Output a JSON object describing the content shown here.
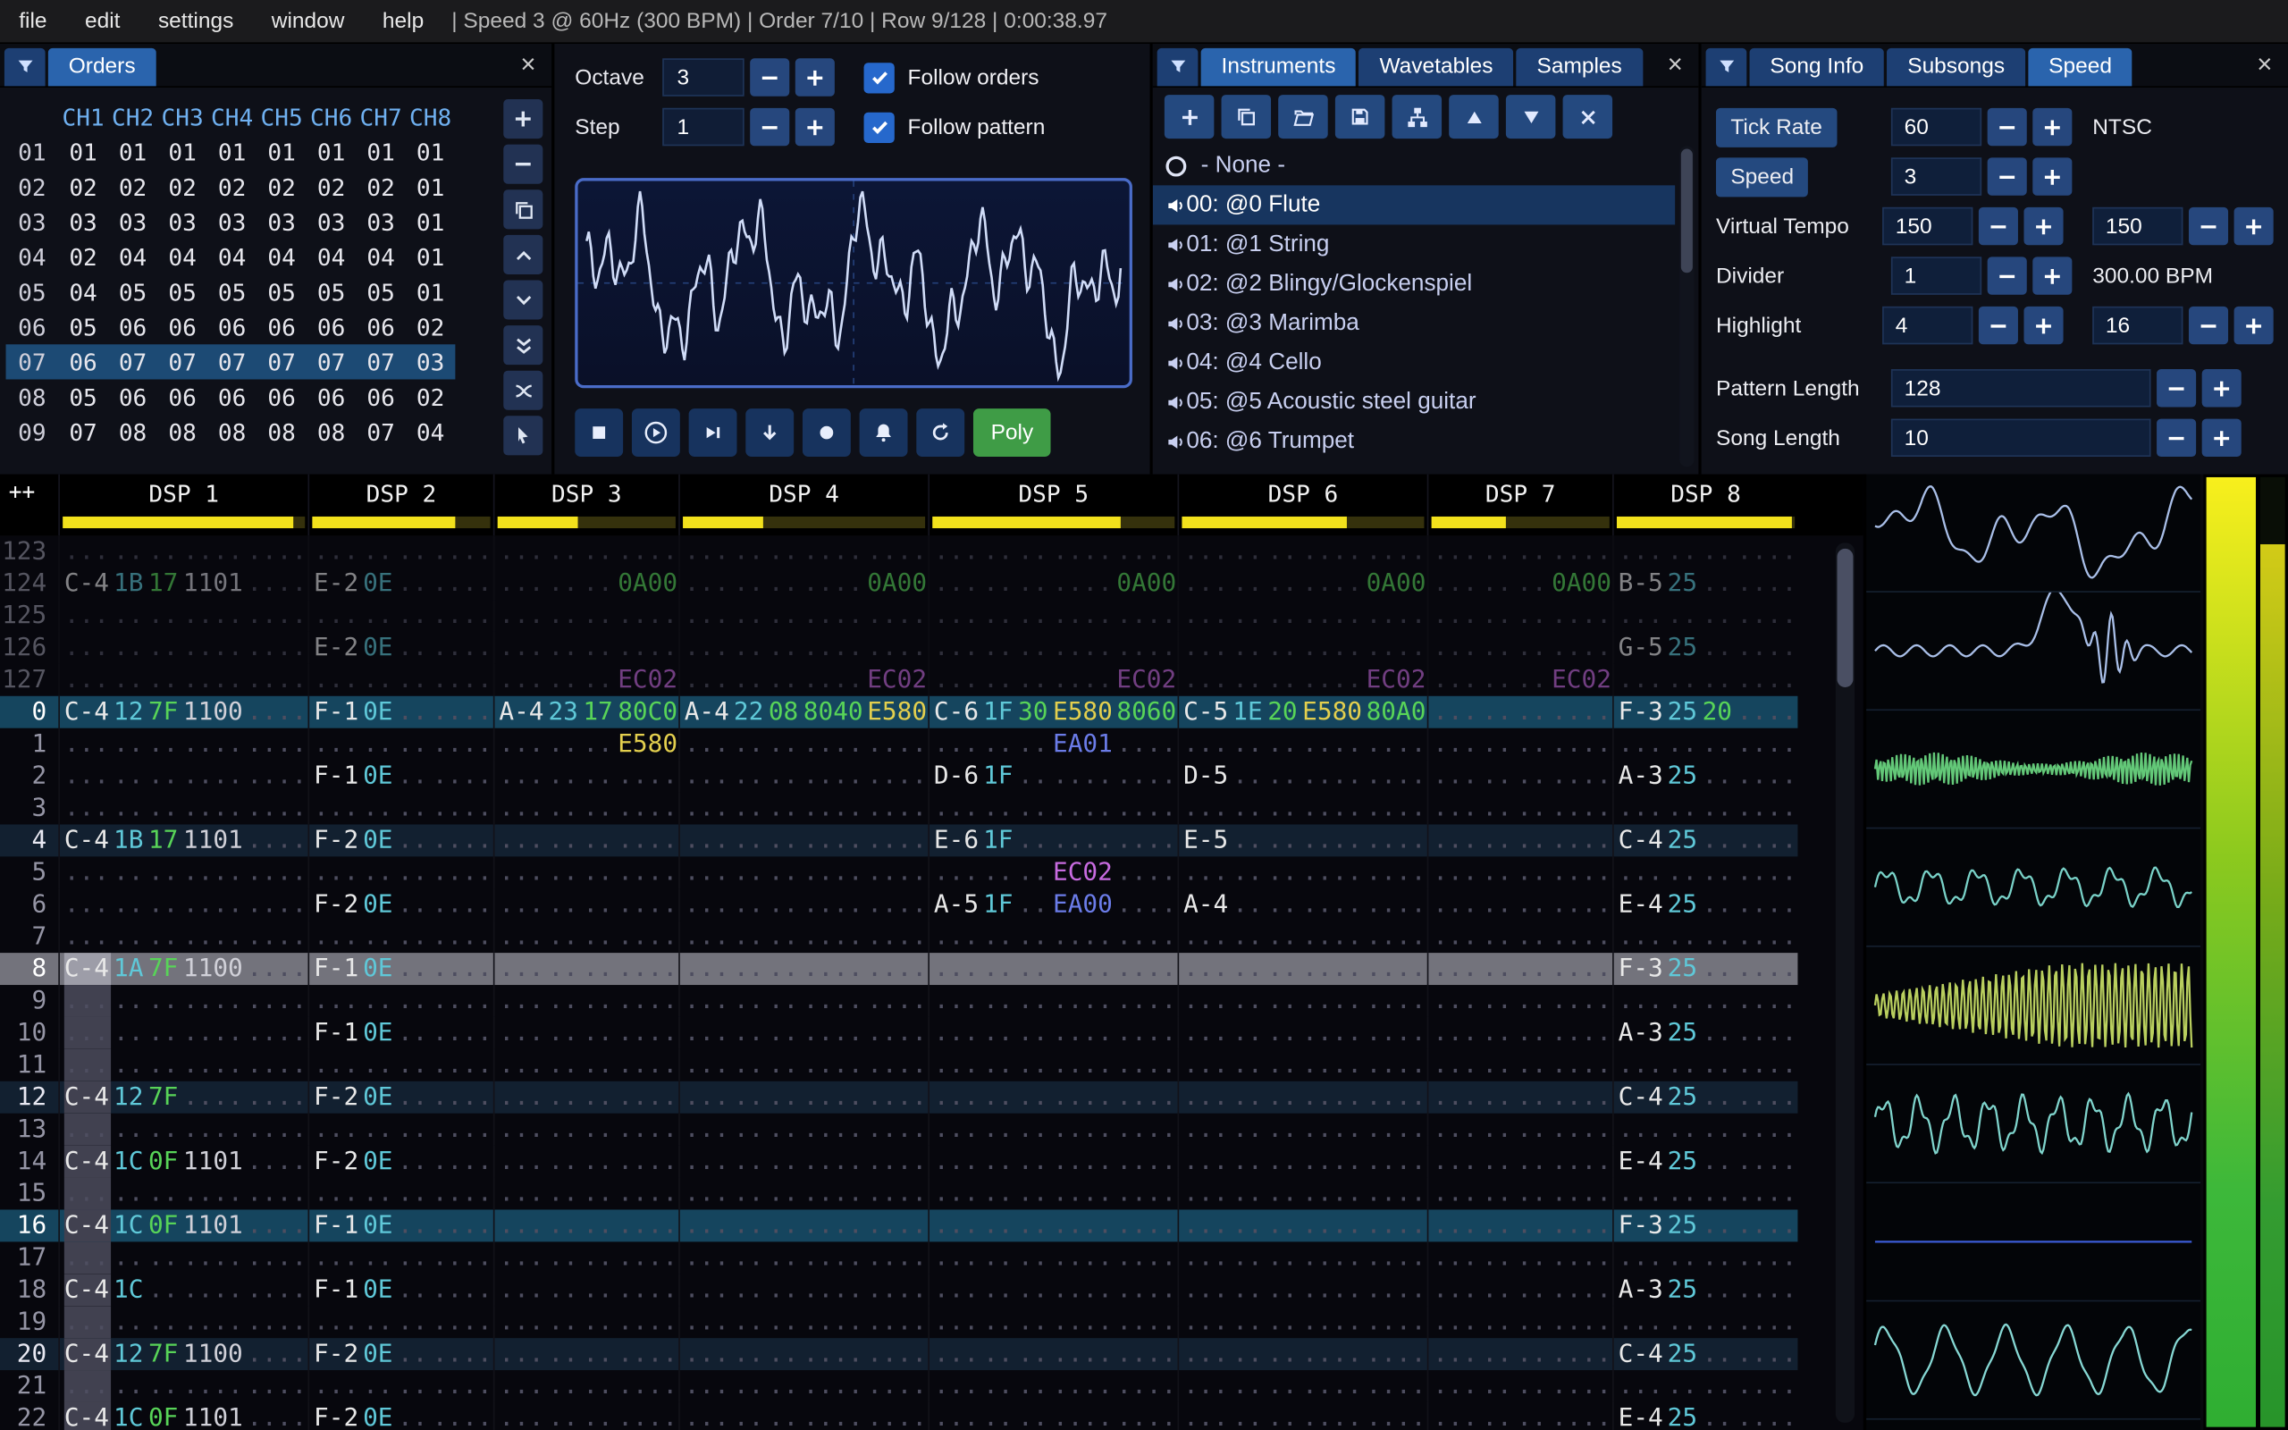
{
  "menu": {
    "items": [
      "file",
      "edit",
      "settings",
      "window",
      "help"
    ],
    "status": "| Speed 3 @ 60Hz (300 BPM) | Order 7/10 | Row 9/128 | 0:00:38.97"
  },
  "orders": {
    "title": "Orders",
    "columns": [
      "CH1",
      "CH2",
      "CH3",
      "CH4",
      "CH5",
      "CH6",
      "CH7",
      "CH8"
    ],
    "rows": [
      {
        "n": "01",
        "v": [
          "01",
          "01",
          "01",
          "01",
          "01",
          "01",
          "01",
          "01"
        ]
      },
      {
        "n": "02",
        "v": [
          "02",
          "02",
          "02",
          "02",
          "02",
          "02",
          "02",
          "01"
        ]
      },
      {
        "n": "03",
        "v": [
          "03",
          "03",
          "03",
          "03",
          "03",
          "03",
          "03",
          "01"
        ]
      },
      {
        "n": "04",
        "v": [
          "02",
          "04",
          "04",
          "04",
          "04",
          "04",
          "04",
          "01"
        ]
      },
      {
        "n": "05",
        "v": [
          "04",
          "05",
          "05",
          "05",
          "05",
          "05",
          "05",
          "01"
        ]
      },
      {
        "n": "06",
        "v": [
          "05",
          "06",
          "06",
          "06",
          "06",
          "06",
          "06",
          "02"
        ]
      },
      {
        "n": "07",
        "v": [
          "06",
          "07",
          "07",
          "07",
          "07",
          "07",
          "07",
          "03"
        ],
        "selected": true
      },
      {
        "n": "08",
        "v": [
          "05",
          "06",
          "06",
          "06",
          "06",
          "06",
          "06",
          "02"
        ]
      },
      {
        "n": "09",
        "v": [
          "07",
          "08",
          "08",
          "08",
          "08",
          "08",
          "07",
          "04"
        ]
      }
    ],
    "buttons": [
      {
        "name": "add-order-button",
        "icon": "plus"
      },
      {
        "name": "remove-order-button",
        "icon": "minus"
      },
      {
        "name": "duplicate-order-button",
        "icon": "copy"
      },
      {
        "name": "move-order-up-button",
        "icon": "chevron-up"
      },
      {
        "name": "move-order-down-button",
        "icon": "chevron-down"
      },
      {
        "name": "duplicate-order-end-button",
        "icon": "double-chevron-down"
      },
      {
        "name": "order-change-mode-button",
        "icon": "crossed-arrows"
      },
      {
        "name": "order-edit-mode-button",
        "icon": "curs"
      }
    ]
  },
  "play": {
    "rows": [
      {
        "name": "octave",
        "label": "Octave",
        "value": "3"
      },
      {
        "name": "step",
        "label": "Step",
        "value": "1"
      }
    ],
    "checkboxes": [
      {
        "name": "follow-orders",
        "label": "Follow orders",
        "checked": true
      },
      {
        "name": "follow-pattern",
        "label": "Follow pattern",
        "checked": true
      }
    ],
    "transport": [
      {
        "name": "stop-button",
        "icon": "stop"
      },
      {
        "name": "play-button",
        "icon": "play"
      },
      {
        "name": "play-from-cursor-button",
        "icon": "play-bar"
      },
      {
        "name": "step-one-row-button",
        "icon": "arrow-down"
      },
      {
        "name": "record-button",
        "icon": "record"
      },
      {
        "name": "metronome-button",
        "icon": "bell"
      },
      {
        "name": "repeat-pattern-button",
        "icon": "repeat"
      }
    ],
    "poly_label": "Poly"
  },
  "instruments": {
    "tabs": [
      {
        "label": "Instruments",
        "active": true
      },
      {
        "label": "Wavetables",
        "active": false
      },
      {
        "label": "Samples",
        "active": false
      }
    ],
    "toolbar": [
      {
        "name": "add-instrument-button",
        "icon": "plus"
      },
      {
        "name": "duplicate-instrument-button",
        "icon": "copy"
      },
      {
        "name": "open-instrument-button",
        "icon": "folder"
      },
      {
        "name": "save-instrument-button",
        "icon": "floppy"
      },
      {
        "name": "instrument-folder-view-button",
        "icon": "tree"
      },
      {
        "name": "move-instrument-up-button",
        "icon": "triangle-up"
      },
      {
        "name": "move-instrument-down-button",
        "icon": "triangle-down"
      },
      {
        "name": "delete-instrument-button",
        "icon": "delete"
      }
    ],
    "none_item": "- None -",
    "items": [
      {
        "label": "00: @0 Flute",
        "selected": true
      },
      {
        "label": "01: @1 String"
      },
      {
        "label": "02: @2 Blingy/Glockenspiel"
      },
      {
        "label": "03: @3 Marimba"
      },
      {
        "label": "04: @4 Cello"
      },
      {
        "label": "05: @5 Acoustic steel guitar"
      },
      {
        "label": "06: @6 Trumpet"
      }
    ]
  },
  "song": {
    "tabs": [
      {
        "label": "Song Info",
        "active": false
      },
      {
        "label": "Subsongs",
        "active": false
      },
      {
        "label": "Speed",
        "active": true
      }
    ],
    "rows": [
      {
        "label": "Tick Rate",
        "button": true,
        "groups": [
          {
            "value": "60"
          }
        ],
        "suffix": "NTSC"
      },
      {
        "label": "Speed",
        "button": true,
        "groups": [
          {
            "value": "3"
          }
        ]
      },
      {
        "label": "Virtual Tempo",
        "groups": [
          {
            "value": "150"
          },
          {
            "value": "150"
          }
        ]
      },
      {
        "label": "Divider",
        "groups": [
          {
            "value": "1"
          }
        ],
        "suffix": "300.00 BPM"
      },
      {
        "label": "Highlight",
        "groups": [
          {
            "value": "4"
          },
          {
            "value": "16"
          }
        ]
      },
      {
        "label": "Pattern Length",
        "wide": true,
        "gap": true,
        "groups": [
          {
            "value": "128"
          }
        ]
      },
      {
        "label": "Song Length",
        "wide": true,
        "groups": [
          {
            "value": "10"
          }
        ]
      }
    ]
  },
  "pattern": {
    "corner": "++",
    "channels": [
      {
        "name": "DSP 1",
        "cols": 5,
        "meter": 0.95
      },
      {
        "name": "DSP 2",
        "cols": 4,
        "meter": 0.8
      },
      {
        "name": "DSP 3",
        "cols": 4,
        "meter": 0.45
      },
      {
        "name": "DSP 4",
        "cols": 5,
        "meter": 0.33
      },
      {
        "name": "DSP 5",
        "cols": 5,
        "meter": 0.78
      },
      {
        "name": "DSP 6",
        "cols": 5,
        "meter": 0.68
      },
      {
        "name": "DSP 7",
        "cols": 4,
        "meter": 0.42
      },
      {
        "name": "DSP 8",
        "cols": 4,
        "meter": 0.98
      }
    ],
    "rows": [
      {
        "n": "123",
        "cls": "prev",
        "c": [
          {},
          {},
          {},
          {},
          {},
          {},
          {},
          {}
        ]
      },
      {
        "n": "124",
        "cls": "prev",
        "c": [
          {
            "n": "C-4",
            "i": "1B",
            "v": "17",
            "f1": [
              "1101",
              "fw"
            ]
          },
          {
            "n": "E-2",
            "i": "0E"
          },
          {
            "f1": [
              "0A00",
              "fg"
            ]
          },
          {
            "f2": [
              "0A00",
              "fg"
            ]
          },
          {
            "f2": [
              "0A00",
              "fg"
            ]
          },
          {
            "f2": [
              "0A00",
              "fg"
            ]
          },
          {
            "f1": [
              "0A00",
              "fg"
            ]
          },
          {
            "n": "B-5",
            "i": "25"
          }
        ]
      },
      {
        "n": "125",
        "cls": "prev",
        "c": [
          {},
          {},
          {},
          {},
          {},
          {},
          {},
          {}
        ]
      },
      {
        "n": "126",
        "cls": "prev",
        "c": [
          {},
          {
            "n": "E-2",
            "i": "0E"
          },
          {},
          {},
          {},
          {},
          {},
          {
            "n": "G-5",
            "i": "25"
          }
        ]
      },
      {
        "n": "127",
        "cls": "prev",
        "c": [
          {},
          {},
          {
            "f1": [
              "EC02",
              "fp"
            ]
          },
          {
            "f2": [
              "EC02",
              "fp"
            ]
          },
          {
            "f2": [
              "EC02",
              "fp"
            ]
          },
          {
            "f2": [
              "EC02",
              "fp"
            ]
          },
          {
            "f1": [
              "EC02",
              "fp"
            ]
          },
          {}
        ]
      },
      {
        "n": "0",
        "cls": "hl16",
        "c": [
          {
            "n": "C-4",
            "i": "12",
            "v": "7F",
            "f1": [
              "1100",
              "fw"
            ]
          },
          {
            "n": "F-1",
            "i": "0E"
          },
          {
            "n": "A-4",
            "i": "23",
            "v": "17",
            "f1": [
              "80C0",
              "fg"
            ]
          },
          {
            "n": "A-4",
            "i": "22",
            "v": "08",
            "f1": [
              "8040",
              "fg"
            ],
            "f2": [
              "E580",
              "fy"
            ]
          },
          {
            "n": "C-6",
            "i": "1F",
            "v": "30",
            "f1": [
              "E580",
              "fy"
            ],
            "f2": [
              "8060",
              "fg"
            ]
          },
          {
            "n": "C-5",
            "i": "1E",
            "v": "20",
            "f1": [
              "E580",
              "fy"
            ],
            "f2": [
              "80A0",
              "fg"
            ]
          },
          {},
          {
            "n": "F-3",
            "i": "25",
            "v": "20"
          }
        ]
      },
      {
        "n": "1",
        "c": [
          {},
          {},
          {
            "f1": [
              "E580",
              "fy"
            ]
          },
          {},
          {
            "f1": [
              "EA01",
              "fb"
            ]
          },
          {},
          {},
          {}
        ]
      },
      {
        "n": "2",
        "c": [
          {},
          {
            "n": "F-1",
            "i": "0E"
          },
          {},
          {},
          {
            "n": "D-6",
            "i": "1F"
          },
          {
            "n": "D-5"
          },
          {},
          {
            "n": "A-3",
            "i": "25"
          }
        ]
      },
      {
        "n": "3",
        "c": [
          {},
          {},
          {},
          {},
          {},
          {},
          {},
          {}
        ]
      },
      {
        "n": "4",
        "cls": "hl4",
        "c": [
          {
            "n": "C-4",
            "i": "1B",
            "v": "17",
            "f1": [
              "1101",
              "fw"
            ]
          },
          {
            "n": "F-2",
            "i": "0E"
          },
          {},
          {},
          {
            "n": "E-6",
            "i": "1F"
          },
          {
            "n": "E-5"
          },
          {},
          {
            "n": "C-4",
            "i": "25"
          }
        ]
      },
      {
        "n": "5",
        "c": [
          {},
          {},
          {},
          {},
          {
            "f1": [
              "EC02",
              "fp"
            ]
          },
          {},
          {},
          {}
        ]
      },
      {
        "n": "6",
        "c": [
          {},
          {
            "n": "F-2",
            "i": "0E"
          },
          {},
          {},
          {
            "n": "A-5",
            "i": "1F",
            "f1": [
              "EA00",
              "fb"
            ]
          },
          {
            "n": "A-4"
          },
          {},
          {
            "n": "E-4",
            "i": "25"
          }
        ]
      },
      {
        "n": "7",
        "c": [
          {},
          {},
          {},
          {},
          {},
          {},
          {},
          {}
        ]
      },
      {
        "n": "8",
        "cls": "cursor",
        "c": [
          {
            "n": "C-4",
            "i": "1A",
            "v": "7F",
            "f1": [
              "1100",
              "fw"
            ],
            "cur": true
          },
          {
            "n": "F-1",
            "i": "0E"
          },
          {},
          {},
          {},
          {},
          {},
          {
            "n": "F-3",
            "i": "25"
          }
        ]
      },
      {
        "n": "9",
        "c": [
          {
            "sel": true
          },
          {},
          {},
          {},
          {},
          {},
          {},
          {}
        ]
      },
      {
        "n": "10",
        "c": [
          {
            "sel": true
          },
          {
            "n": "F-1",
            "i": "0E"
          },
          {},
          {},
          {},
          {},
          {},
          {
            "n": "A-3",
            "i": "25"
          }
        ]
      },
      {
        "n": "11",
        "c": [
          {
            "sel": true
          },
          {},
          {},
          {},
          {},
          {},
          {},
          {}
        ]
      },
      {
        "n": "12",
        "cls": "hl4",
        "c": [
          {
            "n": "C-4",
            "i": "12",
            "v": "7F",
            "sel": true
          },
          {
            "n": "F-2",
            "i": "0E"
          },
          {},
          {},
          {},
          {},
          {},
          {
            "n": "C-4",
            "i": "25"
          }
        ]
      },
      {
        "n": "13",
        "c": [
          {
            "sel": true
          },
          {},
          {},
          {},
          {},
          {},
          {},
          {}
        ]
      },
      {
        "n": "14",
        "c": [
          {
            "n": "C-4",
            "i": "1C",
            "v": "0F",
            "f1": [
              "1101",
              "fw"
            ],
            "sel": true
          },
          {
            "n": "F-2",
            "i": "0E"
          },
          {},
          {},
          {},
          {},
          {},
          {
            "n": "E-4",
            "i": "25"
          }
        ]
      },
      {
        "n": "15",
        "c": [
          {
            "sel": true
          },
          {},
          {},
          {},
          {},
          {},
          {},
          {}
        ]
      },
      {
        "n": "16",
        "cls": "hl16",
        "c": [
          {
            "n": "C-4",
            "i": "1C",
            "v": "0F",
            "f1": [
              "1101",
              "fw"
            ],
            "sel": true
          },
          {
            "n": "F-1",
            "i": "0E"
          },
          {},
          {},
          {},
          {},
          {},
          {
            "n": "F-3",
            "i": "25"
          }
        ]
      },
      {
        "n": "17",
        "c": [
          {
            "sel": true
          },
          {},
          {},
          {},
          {},
          {},
          {},
          {}
        ]
      },
      {
        "n": "18",
        "c": [
          {
            "n": "C-4",
            "i": "1C",
            "sel": true
          },
          {
            "n": "F-1",
            "i": "0E"
          },
          {},
          {},
          {},
          {},
          {},
          {
            "n": "A-3",
            "i": "25"
          }
        ]
      },
      {
        "n": "19",
        "c": [
          {
            "sel": true
          },
          {},
          {},
          {},
          {},
          {},
          {},
          {}
        ]
      },
      {
        "n": "20",
        "cls": "hl4",
        "c": [
          {
            "n": "C-4",
            "i": "12",
            "v": "7F",
            "f1": [
              "1100",
              "fw"
            ],
            "sel": true
          },
          {
            "n": "F-2",
            "i": "0E"
          },
          {},
          {},
          {},
          {},
          {},
          {
            "n": "C-4",
            "i": "25"
          }
        ]
      },
      {
        "n": "21",
        "c": [
          {
            "sel": true
          },
          {},
          {},
          {},
          {},
          {},
          {},
          {}
        ]
      },
      {
        "n": "22",
        "c": [
          {
            "n": "C-4",
            "i": "1C",
            "v": "0F",
            "f1": [
              "1101",
              "fw"
            ],
            "sel": true
          },
          {
            "n": "F-2",
            "i": "0E"
          },
          {},
          {},
          {},
          {},
          {},
          {
            "n": "E-4",
            "i": "25"
          }
        ]
      }
    ]
  },
  "scopes": {
    "channels": [
      {
        "name": "scope-ch1",
        "kind": "complex",
        "color": "#a9bfe8"
      },
      {
        "name": "scope-ch2",
        "kind": "peak",
        "color": "#a9bfe8"
      },
      {
        "name": "scope-ch3",
        "kind": "dense-small",
        "color": "#63c878"
      },
      {
        "name": "scope-ch4",
        "kind": "ripple",
        "color": "#79d2c8"
      },
      {
        "name": "scope-ch5",
        "kind": "dense-large",
        "color": "#b9cf5e"
      },
      {
        "name": "scope-ch6",
        "kind": "wavy",
        "color": "#7fd4cc"
      },
      {
        "name": "scope-ch7",
        "kind": "flat",
        "color": "#3b5bd6"
      },
      {
        "name": "scope-ch8",
        "kind": "sine",
        "color": "#86d8d4"
      }
    ]
  },
  "meters": {
    "left": 1.0,
    "right": 0.93
  }
}
